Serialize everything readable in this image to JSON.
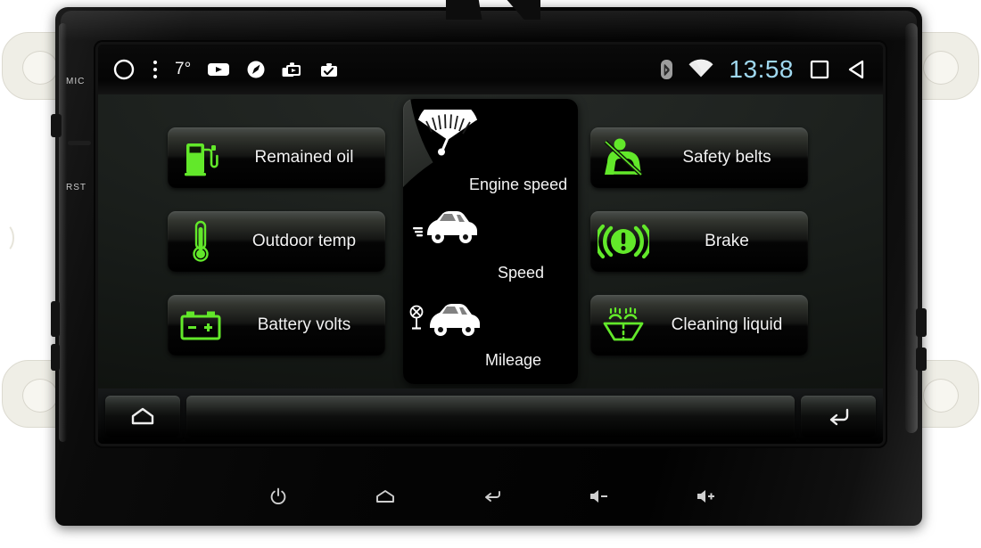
{
  "device": {
    "bezel_labels": {
      "mic": "MIC",
      "reset": "RST"
    }
  },
  "statusbar": {
    "home_circle_icon": "circle-outline-icon",
    "overflow_icon": "overflow-menu-icon",
    "temperature": "7°",
    "video_icon": "video-player-icon",
    "navigation_icon": "navigation-compass-icon",
    "camera_icon": "camera-icon",
    "dvr_icon": "dvr-record-icon",
    "bluetooth_icon": "bluetooth-icon",
    "wifi_icon": "wifi-icon",
    "clock": "13:58",
    "clock_color": "#9fd8ef",
    "recents_icon": "recents-square-icon",
    "back_icon": "back-triangle-icon"
  },
  "theme": {
    "accent_green": "#62e82a",
    "tile_text": "#f2f2f2",
    "screen_bg": "#000000"
  },
  "main": {
    "left_tiles": [
      {
        "label": "Remained oil",
        "icon": "fuel-pump-icon"
      },
      {
        "label": "Outdoor temp",
        "icon": "thermometer-icon"
      },
      {
        "label": "Battery volts",
        "icon": "car-battery-icon"
      }
    ],
    "right_tiles": [
      {
        "label": "Safety belts",
        "icon": "seatbelt-icon"
      },
      {
        "label": "Brake",
        "icon": "brake-warning-icon"
      },
      {
        "label": "Cleaning liquid",
        "icon": "washer-fluid-icon"
      }
    ],
    "center_items": [
      {
        "label": "Engine speed",
        "icon": "tachometer-fan-icon"
      },
      {
        "label": "Speed",
        "icon": "car-speed-icon"
      },
      {
        "label": "Mileage",
        "icon": "car-mileage-icon"
      }
    ]
  },
  "navbar": {
    "home_label": "home-button",
    "home_icon": "home-icon",
    "tray_label": "app-tray",
    "back_label": "back-button",
    "back_icon": "return-arrow-icon"
  },
  "hardware_buttons": [
    {
      "name": "power-button",
      "icon": "power-icon"
    },
    {
      "name": "home-button",
      "icon": "home-icon"
    },
    {
      "name": "back-button",
      "icon": "back-arrow-icon"
    },
    {
      "name": "volume-down-button",
      "icon": "volume-minus-icon"
    },
    {
      "name": "volume-up-button",
      "icon": "volume-plus-icon"
    }
  ]
}
